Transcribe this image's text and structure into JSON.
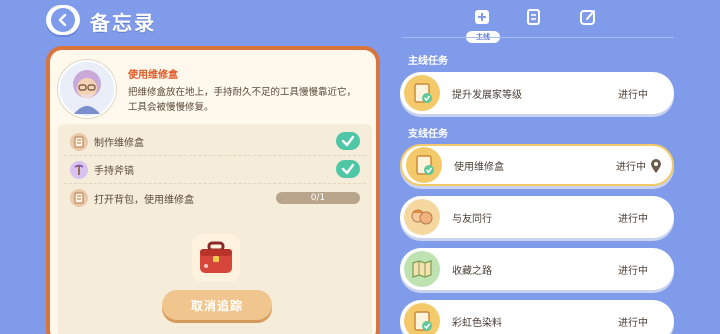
{
  "header": {
    "title": "备忘录",
    "back_icon": "back-arrow-icon"
  },
  "tabs": {
    "items": [
      {
        "icon": "quest-book-icon",
        "label": "主线"
      },
      {
        "icon": "notes-icon"
      },
      {
        "icon": "edit-icon"
      }
    ]
  },
  "task": {
    "name": "使用维修盒",
    "description": "把维修盒放在地上，手持耐久不足的工具慢慢靠近它，工具会被慢慢修复。",
    "steps": [
      {
        "label": "制作维修盒",
        "done": true
      },
      {
        "label": "手持斧镐",
        "done": true
      },
      {
        "label": "打开背包，使用维修盒",
        "done": false,
        "progress_text": "0/1",
        "progress": 0
      }
    ],
    "cancel_label": "取消追踪"
  },
  "sections": {
    "main_title": "主线任务",
    "side_title": "支线任务"
  },
  "quests": [
    {
      "name": "提升发展家等级",
      "status": "进行中",
      "section": "main",
      "active": false
    },
    {
      "name": "使用维修盒",
      "status": "进行中",
      "section": "side",
      "active": true
    },
    {
      "name": "与友同行",
      "status": "进行中",
      "section": "side",
      "active": false
    },
    {
      "name": "收藏之路",
      "status": "进行中",
      "section": "side",
      "active": false
    },
    {
      "name": "彩虹色染料",
      "status": "进行中",
      "section": "side",
      "active": false
    }
  ],
  "colors": {
    "background": "#7f9bea",
    "card_border": "#d9743c",
    "check": "#4fc7a6",
    "active_border": "#f3c96a"
  }
}
